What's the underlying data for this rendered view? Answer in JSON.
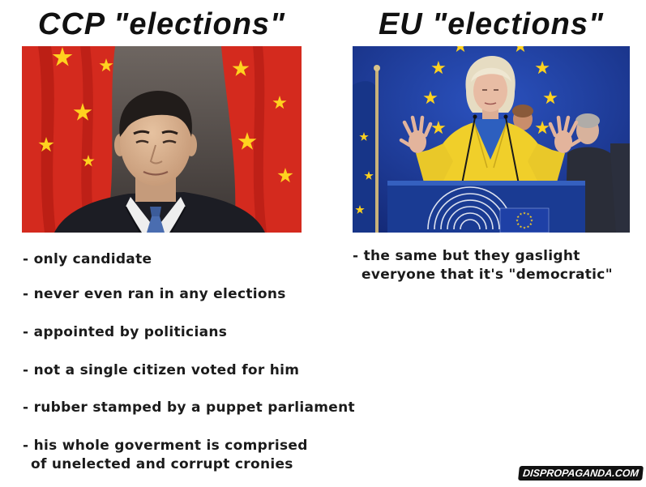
{
  "left_panel": {
    "title": "CCP \"elections\"",
    "bullets": [
      {
        "lines": [
          "- only candidate"
        ]
      },
      {
        "lines": [
          "- never even ran in any elections"
        ]
      },
      {
        "lines": [
          "- appointed by politicians"
        ]
      },
      {
        "lines": [
          "- not a single citizen voted for him"
        ]
      },
      {
        "lines": [
          "- rubber stamped by a puppet parliament"
        ]
      },
      {
        "lines": [
          "- his whole goverment is comprised",
          "of unelected and corrupt cronies"
        ]
      }
    ]
  },
  "right_panel": {
    "title": "EU \"elections\"",
    "bullets": [
      {
        "lines": [
          "- the same but they gaslight",
          "everyone that it's \"democratic\""
        ]
      }
    ]
  },
  "watermark": "DISPROPAGANDA.COM",
  "colors": {
    "text": "#111111",
    "china_flag_red": "#d42a1e",
    "flag_star_yellow": "#ffd21f",
    "eu_blue": "#1e3590",
    "jacket_yellow": "#f0cf2a"
  }
}
